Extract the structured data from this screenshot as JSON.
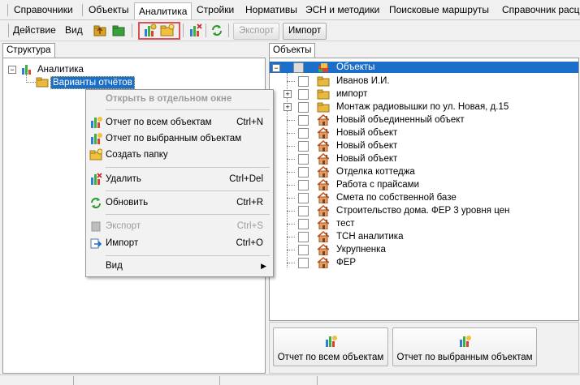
{
  "menubar": {
    "items": [
      "Справочники",
      "Объекты",
      "Аналитика",
      "Стройки",
      "Нормативы",
      "ЭСН и методики",
      "Поисковые маршруты",
      "Справочник расц"
    ],
    "active": "Аналитика"
  },
  "toolbar": {
    "action_label": "Действие",
    "view_label": "Вид",
    "export_label": "Экспорт",
    "import_label": "Импорт",
    "icons": [
      "folder-up-icon",
      "folder-new-icon",
      "report-all-icon",
      "new-folder-icon",
      "delete-report-icon",
      "refresh-icon"
    ]
  },
  "left_panel": {
    "tab_label": "Структура",
    "root_label": "Аналитика",
    "child_label": "Варианты отчётов"
  },
  "context_menu": {
    "open_new_window": "Открыть в отдельном окне",
    "report_all": "Отчет по всем объектам",
    "report_all_shortcut": "Ctrl+N",
    "report_selected": "Отчет по выбранным объектам",
    "create_folder": "Создать папку",
    "delete": "Удалить",
    "delete_shortcut": "Ctrl+Del",
    "refresh": "Обновить",
    "refresh_shortcut": "Ctrl+R",
    "export": "Экспорт",
    "export_shortcut": "Ctrl+S",
    "import": "Импорт",
    "import_shortcut": "Ctrl+O",
    "view": "Вид"
  },
  "right_panel": {
    "tab_label": "Объекты",
    "root_label": "Объекты",
    "rows": [
      {
        "label": "Иванов И.И.",
        "type": "folder",
        "expander": false
      },
      {
        "label": "импорт",
        "type": "folder",
        "expander": true
      },
      {
        "label": "Монтаж радиовышки по ул. Новая, д.15",
        "type": "folder",
        "expander": true
      },
      {
        "label": "Новый объединенный объект",
        "type": "house",
        "expander": false
      },
      {
        "label": "Новый объект",
        "type": "house",
        "expander": false
      },
      {
        "label": "Новый объект",
        "type": "house",
        "expander": false
      },
      {
        "label": "Новый объект",
        "type": "house",
        "expander": false
      },
      {
        "label": "Отделка коттеджа",
        "type": "house",
        "expander": false
      },
      {
        "label": "Работа с прайсами",
        "type": "house",
        "expander": false
      },
      {
        "label": "Смета по собственной базе",
        "type": "house",
        "expander": false
      },
      {
        "label": "Строительство дома. ФЕР 3 уровня цен",
        "type": "house",
        "expander": false
      },
      {
        "label": "тест",
        "type": "house",
        "expander": false
      },
      {
        "label": "ТСН аналитика",
        "type": "house",
        "expander": false
      },
      {
        "label": "Укрупненка",
        "type": "house",
        "expander": false
      },
      {
        "label": "ФЕР",
        "type": "house",
        "expander": false
      }
    ]
  },
  "bottom_buttons": {
    "all_label": "Отчет по всем объектам",
    "selected_label": "Отчет по выбранным объектам"
  },
  "colors": {
    "selection": "#1c6fc9",
    "highlight_box": "#e05050",
    "folder": "#f0c040"
  }
}
